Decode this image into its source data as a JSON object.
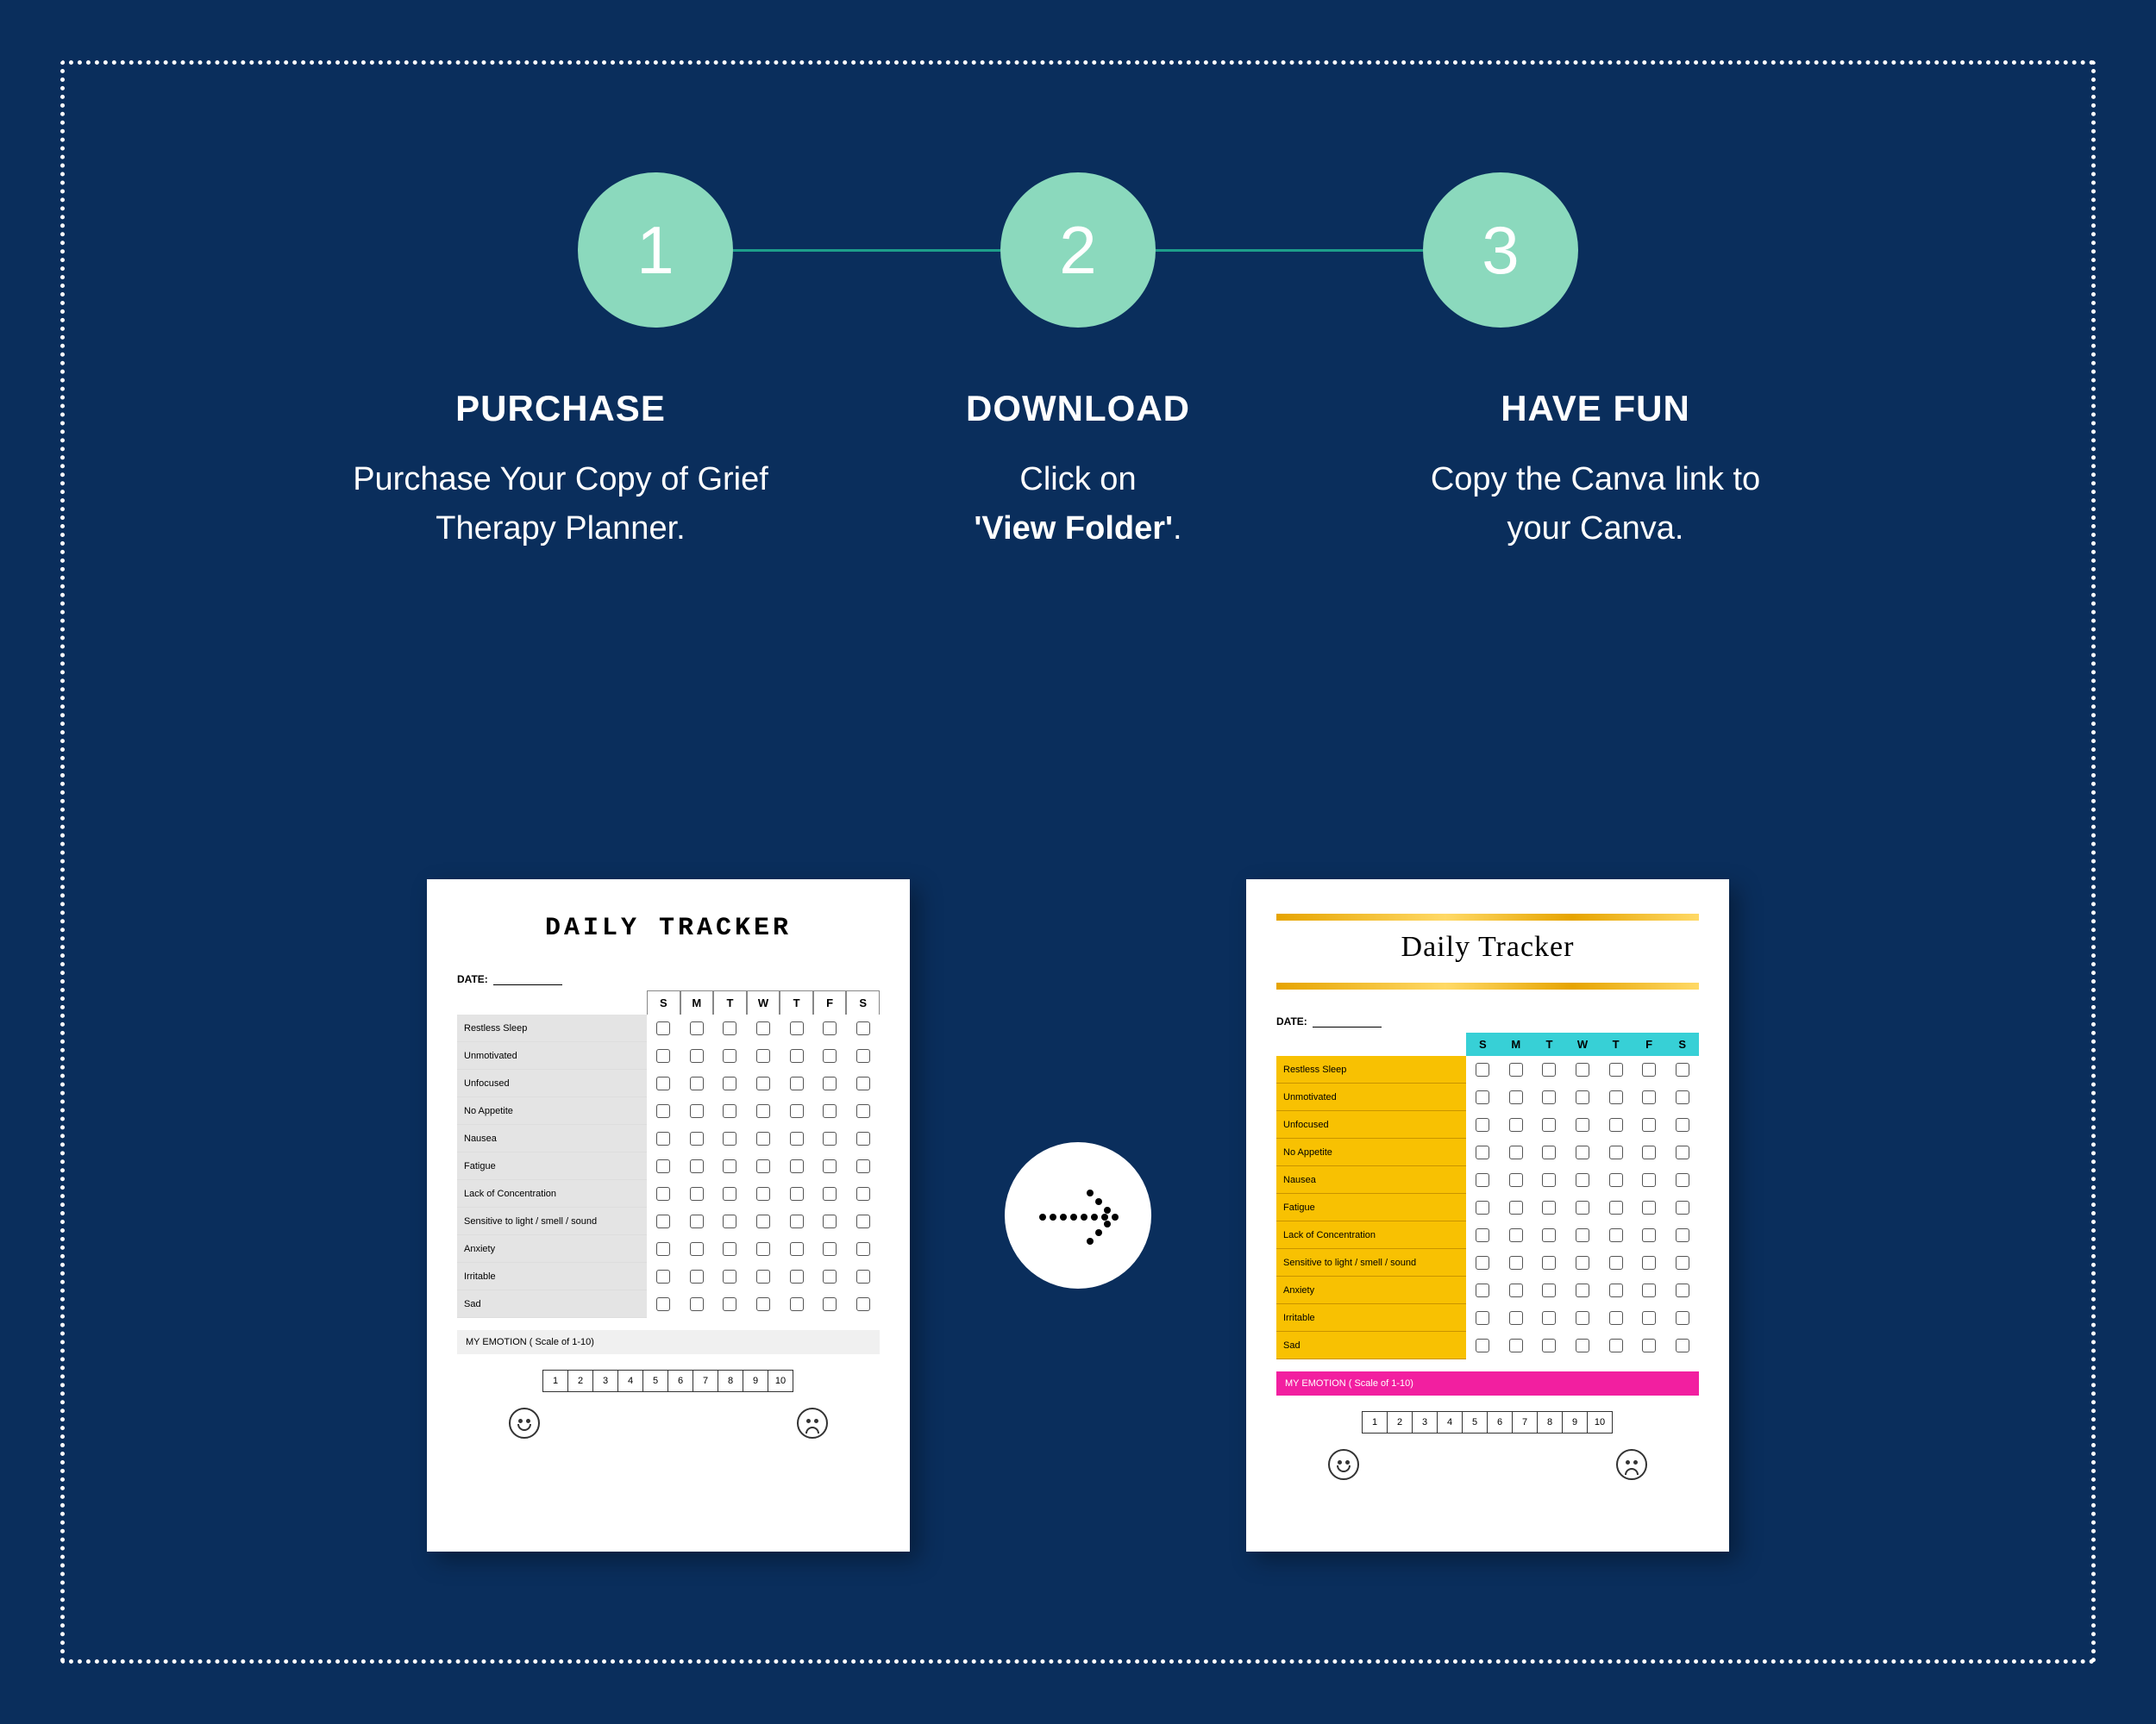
{
  "steps": [
    {
      "num": "1",
      "title": "PURCHASE",
      "desc": "Purchase Your Copy of Grief Therapy Planner."
    },
    {
      "num": "2",
      "title": "DOWNLOAD",
      "desc_pre": "Click  on",
      "desc_bold": "'View Folder'",
      "desc_post": "."
    },
    {
      "num": "3",
      "title": "HAVE FUN",
      "desc": "Copy the Canva link to\nyour Canva."
    }
  ],
  "tracker": {
    "title_plain": "DAILY TRACKER",
    "title_styled": "Daily Tracker",
    "date_label": "DATE:",
    "days": [
      "S",
      "M",
      "T",
      "W",
      "T",
      "F",
      "S"
    ],
    "rows": [
      "Restless Sleep",
      "Unmotivated",
      "Unfocused",
      "No Appetite",
      "Nausea",
      "Fatigue",
      "Lack of Concentration",
      "Sensitive to light / smell / sound",
      "Anxiety",
      "Irritable",
      "Sad"
    ],
    "emotion_label": "MY EMOTION  ( Scale  of   1-10)",
    "scale": [
      "1",
      "2",
      "3",
      "4",
      "5",
      "6",
      "7",
      "8",
      "9",
      "10"
    ]
  }
}
